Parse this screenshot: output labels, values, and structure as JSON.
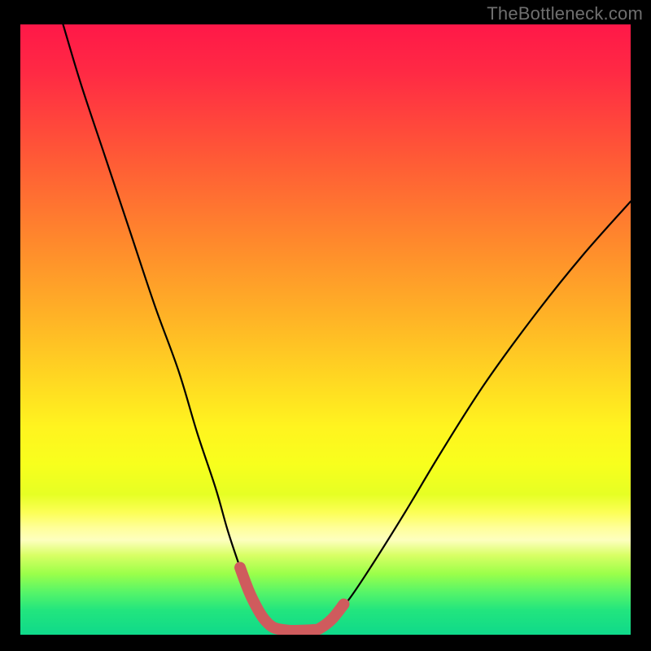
{
  "watermark": "TheBottleneck.com",
  "colors": {
    "page_bg": "#000000",
    "watermark": "#6f6f6f",
    "curve": "#000000",
    "overlay": "#cf5b5d"
  },
  "chart_data": {
    "type": "line",
    "title": "",
    "xlabel": "",
    "ylabel": "",
    "xlim": [
      0,
      100
    ],
    "ylim": [
      0,
      100
    ],
    "grid": false,
    "legend": false,
    "note": "V-shaped bottleneck curve on a rainbow heat gradient; no axes, ticks, or labels are shown — values are estimated from geometry in percent of plot width/height.",
    "series": [
      {
        "name": "left-branch",
        "x": [
          7,
          10,
          14,
          18,
          22,
          26,
          29,
          32,
          34,
          36,
          37.5,
          39,
          40,
          41,
          42
        ],
        "y": [
          100,
          90,
          78,
          66,
          54,
          43,
          33,
          24,
          17,
          11,
          7,
          4,
          2.5,
          1.5,
          1
        ]
      },
      {
        "name": "floor",
        "x": [
          42,
          44,
          46,
          48,
          49
        ],
        "y": [
          1,
          0.7,
          0.7,
          0.8,
          1
        ]
      },
      {
        "name": "right-branch",
        "x": [
          49,
          51,
          54,
          58,
          63,
          69,
          76,
          84,
          92,
          100
        ],
        "y": [
          1,
          2.5,
          6,
          12,
          20,
          30,
          41,
          52,
          62,
          71
        ]
      }
    ],
    "overlay": {
      "name": "valley-highlight",
      "color": "#cf5b5d",
      "x": [
        36,
        37.5,
        39,
        40,
        41,
        42,
        44,
        46,
        48,
        49,
        51,
        53
      ],
      "y": [
        11,
        7,
        4,
        2.5,
        1.5,
        1,
        0.7,
        0.7,
        0.8,
        1,
        2.5,
        5
      ]
    }
  }
}
